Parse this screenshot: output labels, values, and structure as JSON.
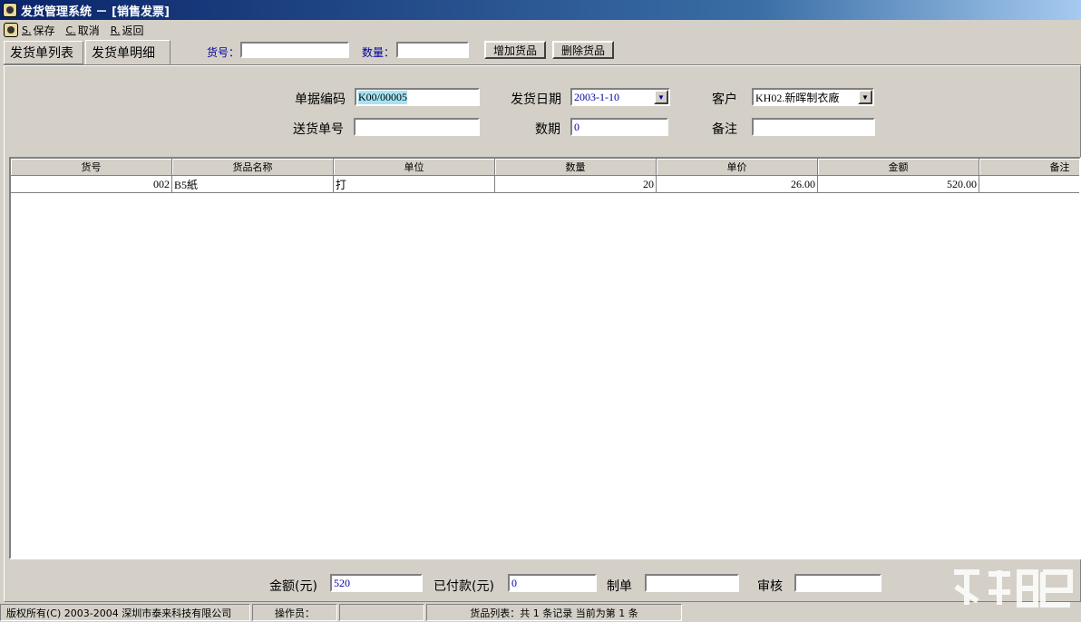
{
  "window": {
    "title": "发货管理系统 － [销售发票]"
  },
  "menu": [
    {
      "key": "S.",
      "label": "保存"
    },
    {
      "key": "C.",
      "label": "取消"
    },
    {
      "key": "R.",
      "label": "返回"
    }
  ],
  "tabs": [
    {
      "label": "发货单列表",
      "active": false
    },
    {
      "label": "发货单明细",
      "active": true
    }
  ],
  "toolbar": {
    "item_no_label": "货号：",
    "item_no_value": "",
    "qty_label": "数量：",
    "qty_value": "",
    "add_button": "增加货品",
    "delete_button": "删除货品"
  },
  "form": {
    "doc_code_label": "单据编码",
    "doc_code_value": "K00/00005",
    "ship_date_label": "发货日期",
    "ship_date_value": "2003-1-10",
    "customer_label": "客户",
    "customer_value": "KH02.新晖制衣廠",
    "delivery_no_label": "送货单号",
    "delivery_no_value": "",
    "period_label": "数期",
    "period_value": "0",
    "remark_label": "备注",
    "remark_value": ""
  },
  "grid": {
    "columns": [
      "货号",
      "货品名称",
      "单位",
      "数量",
      "单价",
      "金额",
      "备注"
    ],
    "rows": [
      [
        "002",
        "B5紙",
        "打",
        "20",
        "26.00",
        "520.00",
        ""
      ]
    ]
  },
  "totals": {
    "amount_label": "金额(元)",
    "amount_value": "520",
    "paid_label": "已付款(元)",
    "paid_value": "0",
    "maker_label": "制单",
    "maker_value": "",
    "auditor_label": "审核",
    "auditor_value": ""
  },
  "status": {
    "copyright": "版权所有(C) 2003-2004  深圳市泰来科技有限公司",
    "operator_label": "操作员：",
    "operator_value": "",
    "records": "货品列表：共 1 条记录 当前为第 1 条"
  },
  "colors": {
    "selection": "#a6e3f5",
    "title_bar": "#0a246a",
    "label_blue": "#0000a0"
  }
}
